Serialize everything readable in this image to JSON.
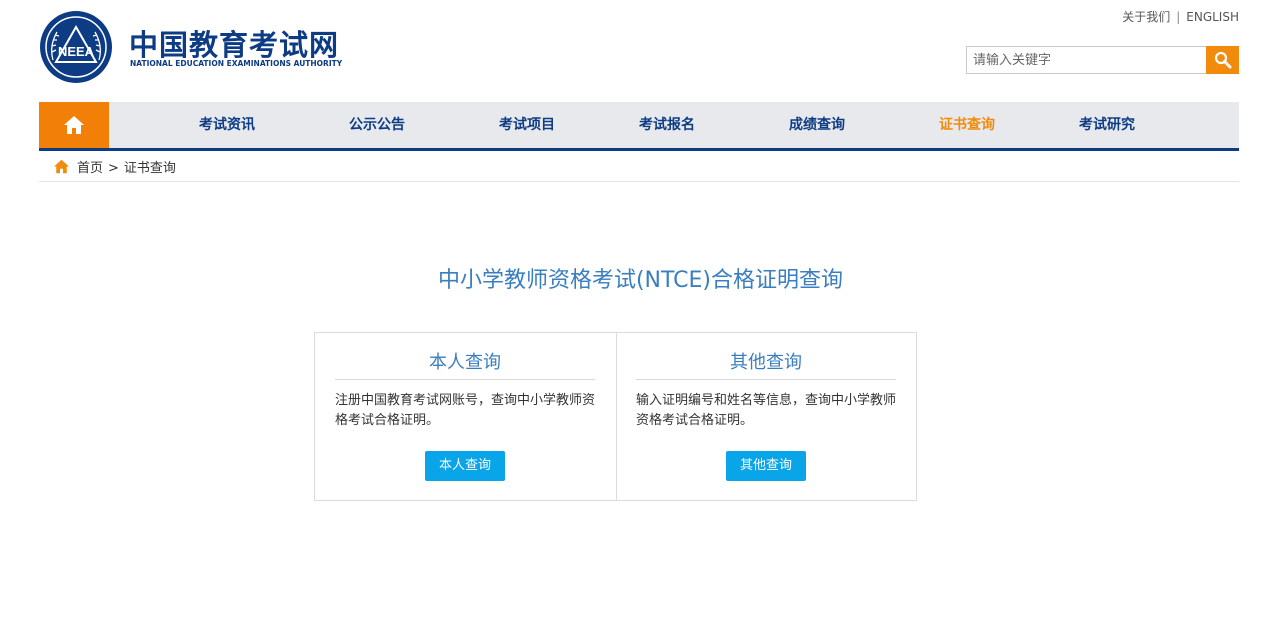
{
  "header": {
    "brand_cn": "中国教育考试网",
    "brand_en": "NATIONAL EDUCATION EXAMINATIONS AUTHORITY",
    "logo_text": "NEEA",
    "about": "关于我们",
    "separator": "|",
    "english": "ENGLISH",
    "search_placeholder": "请输入关键字"
  },
  "nav": {
    "items": [
      {
        "label": "考试资讯"
      },
      {
        "label": "公示公告"
      },
      {
        "label": "考试项目"
      },
      {
        "label": "考试报名"
      },
      {
        "label": "成绩查询"
      },
      {
        "label": "证书查询"
      },
      {
        "label": "考试研究"
      }
    ]
  },
  "breadcrumb": {
    "home": "首页",
    "separator": ">",
    "current": "证书查询"
  },
  "main": {
    "title": "中小学教师资格考试(NTCE)合格证明查询",
    "cards": [
      {
        "heading": "本人查询",
        "desc": "注册中国教育考试网账号，查询中小学教师资格考试合格证明。",
        "button": "本人查询"
      },
      {
        "heading": "其他查询",
        "desc": "输入证明编号和姓名等信息，查询中小学教师资格考试合格证明。",
        "button": "其他查询"
      }
    ]
  },
  "colors": {
    "brand_blue": "#0d3c84",
    "accent_orange": "#f28b0b",
    "title_blue": "#3a7ec0",
    "button_blue": "#0aa5e8"
  }
}
